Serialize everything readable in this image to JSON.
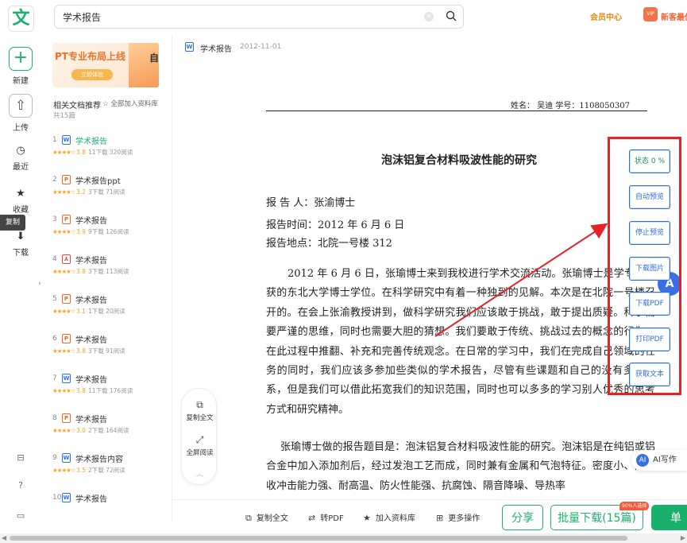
{
  "app": {
    "logo_char": "文"
  },
  "rail": {
    "new": "新建",
    "upload": "上传",
    "recent": "最近",
    "favorite": "收藏",
    "download": "下载",
    "copy_tag": "复制"
  },
  "search": {
    "value": "学术报告"
  },
  "header": {
    "vip_center": "会员中心",
    "vip_icon": "VIP",
    "vip_gift": "新客最优"
  },
  "sidebar": {
    "banner_title": "PT专业布局上线",
    "banner_button": "立即体验",
    "banner_side": "自",
    "related_title": "相关文档推荐",
    "add_all": "全部加入资料库",
    "count": "共15篇",
    "items": [
      {
        "num": "1",
        "type": "W",
        "title": "学术报告",
        "score": "3.8",
        "pages": "11下载",
        "reads": "320阅读",
        "active": true
      },
      {
        "num": "2",
        "type": "P",
        "title": "学术报告ppt",
        "score": "3.2",
        "pages": "3下载",
        "reads": "71阅读"
      },
      {
        "num": "3",
        "type": "P",
        "title": "学术报告",
        "score": "3.9",
        "pages": "9下载",
        "reads": "126阅读"
      },
      {
        "num": "4",
        "type": "PDF",
        "title": "学术报告",
        "score": "3.8",
        "pages": "3下载",
        "reads": "113阅读"
      },
      {
        "num": "5",
        "type": "P",
        "title": "学术报告",
        "score": "3.1",
        "pages": "1下载",
        "reads": "20阅读"
      },
      {
        "num": "6",
        "type": "P",
        "title": "学术报告",
        "score": "3.8",
        "pages": "3下载",
        "reads": "91阅读"
      },
      {
        "num": "7",
        "type": "W",
        "title": "学术报告",
        "score": "3.8",
        "pages": "11下载",
        "reads": "176阅读"
      },
      {
        "num": "8",
        "type": "P",
        "title": "学术报告",
        "score": "3.0",
        "pages": "2下载",
        "reads": "164阅读"
      },
      {
        "num": "9",
        "type": "W",
        "title": "学术报告内容",
        "score": "3.5",
        "pages": "2下载",
        "reads": "72阅读"
      },
      {
        "num": "10",
        "type": "W",
        "title": "学术报告",
        "score": "",
        "pages": "",
        "reads": ""
      }
    ]
  },
  "doc": {
    "type": "W",
    "title": "学术报告",
    "date": "2012-11-01",
    "paper": {
      "name_line": "姓名：    吴迪    学号：1108050307",
      "heading": "泡沫铝复合材料吸波性能的研究",
      "reporter": "报  告  人：张渝博士",
      "time": "报告时间：2012 年 6 月 6 日",
      "place": "报告地点：北院一号楼 312",
      "para1": "2012 年 6 月 6 日，张瑜博士来到我校进行学术交流活动。张瑜博士是学专家，获的东北大学博士学位。在科学研究中有着一种独到的见解。本次是在北院一号楼召开的。在会上张渝教授讲到，做科学研究我们应该敢于挑战，敢于提出质疑。科学需要严谨的思维，同时也需要大胆的猜想。我们要敢于传统、挑战过去的概念的行为，在此过程中推翻、补充和完善传统观念。在日常的学习中，我们在完成自己领域的任务的同时，我们应该多参加些类似的学术报告，尽管有些课题和自己的没有多少关系，但是我们可以借此拓宽我们的知识范围，同时也可以多多的学习别人优秀的思考方式和研究精神。",
      "para2": "张瑜博士做的报告题目是：泡沫铝复合材料吸波性能的研究。泡沫铝是在纯铝或铝合金中加入添加剂后，经过发泡工艺而成，同时兼有金属和气泡特征。密度小、高吸收冲击能力强、耐高温、防火性能强、抗腐蚀、隔音降噪、导热率"
    }
  },
  "float_tools": {
    "copy_all": "复制全文",
    "fullscreen": "全屏阅读"
  },
  "plugin": {
    "status": "状态 0 %",
    "auto_preview": "自动预览",
    "stop_preview": "停止预览",
    "download_images": "下载图片",
    "download_pdf": "下载PDF",
    "print_pdf": "打印PDF",
    "get_text": "获取文本"
  },
  "ai_write": {
    "icon": "AI",
    "label": "AI写作"
  },
  "bottom": {
    "copy_all": "复制全文",
    "to_pdf": "转PDF",
    "add_library": "加入资料库",
    "more": "更多操作",
    "share": "分享",
    "batch_download": "批量下载(15篇)",
    "batch_tag": "90%人选择",
    "single": "单"
  },
  "colors": {
    "brand_green": "#1cb26c",
    "plugin_blue": "#2d6ed8",
    "annotation_red": "#e42424",
    "vip_orange": "#e38b11"
  }
}
